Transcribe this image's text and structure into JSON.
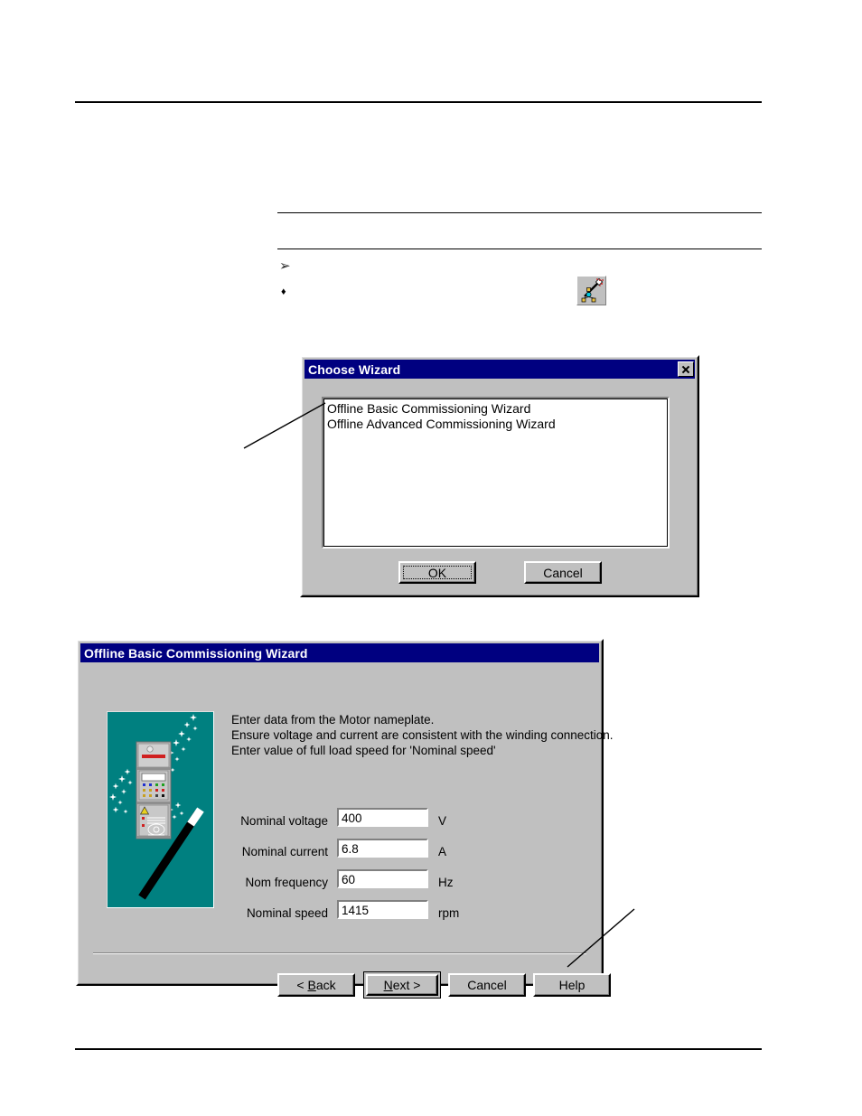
{
  "page": {
    "rules": {
      "header": "horizontal-rule",
      "footer": "horizontal-rule"
    },
    "bullets": {
      "arrow": "➢",
      "diamond": "♦"
    },
    "toolbar_icon_name": "commissioning-wizard-toolbar-icon"
  },
  "choose_wizard_dialog": {
    "title": "Choose Wizard",
    "close_label": "✕",
    "list_items": [
      "Offline Basic Commissioning Wizard",
      "Offline Advanced Commissioning Wizard"
    ],
    "buttons": {
      "ok": "OK",
      "cancel": "Cancel"
    }
  },
  "commissioning_wizard_dialog": {
    "title": "Offline Basic Commissioning Wizard",
    "instructions": [
      "Enter data from the Motor nameplate.",
      "Ensure voltage and current are consistent with the winding connection.",
      "Enter value of full load speed for 'Nominal speed'"
    ],
    "graphic": {
      "name": "drive-and-magic-wand-illustration",
      "background_color": "#008080",
      "cabinet_color": "#c0c0c0",
      "wand_color": "#000000",
      "sparkle_color": "#ffffff"
    },
    "fields": [
      {
        "label": "Nominal voltage",
        "value": "400",
        "unit": "V"
      },
      {
        "label": "Nominal current",
        "value": "6.8",
        "unit": "A"
      },
      {
        "label": "Nom frequency",
        "value": "60",
        "unit": "Hz"
      },
      {
        "label": "Nominal speed",
        "value": "1415",
        "unit": "rpm"
      }
    ],
    "buttons": {
      "back": {
        "prefix": "< ",
        "accel": "B",
        "rest": "ack"
      },
      "next": {
        "prefix": "",
        "accel": "N",
        "rest": "ext >"
      },
      "cancel": "Cancel",
      "help": "Help"
    }
  },
  "colors": {
    "titlebar": "#000080",
    "dialog_face": "#c0c0c0",
    "graphic_teal": "#008080",
    "text": "#000000"
  }
}
